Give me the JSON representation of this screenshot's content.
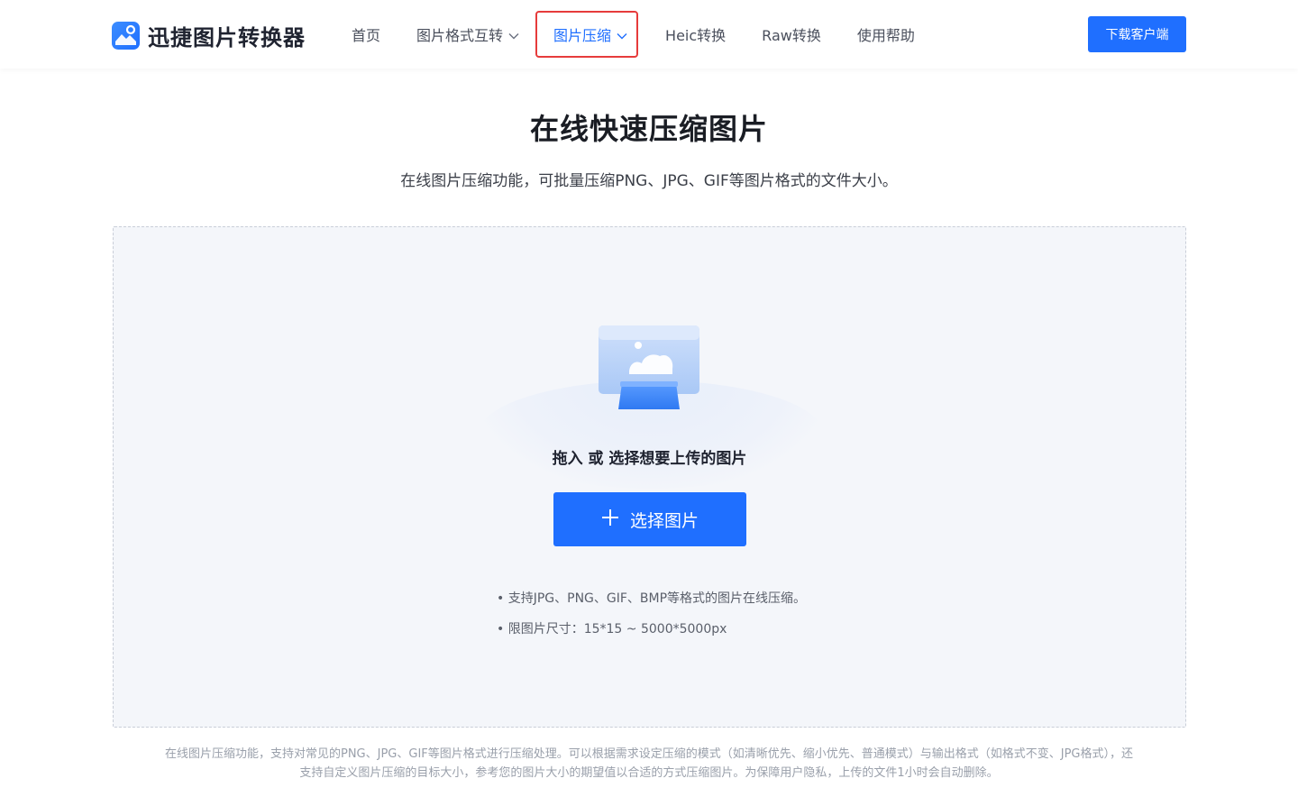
{
  "header": {
    "logo_text": "迅捷图片转换器",
    "nav": [
      {
        "label": "首页"
      },
      {
        "label": "图片格式互转"
      },
      {
        "label": "图片压缩"
      },
      {
        "label": "Heic转换"
      },
      {
        "label": "Raw转换"
      },
      {
        "label": "使用帮助"
      }
    ],
    "download_label": "下载客户端"
  },
  "hero": {
    "title": "在线快速压缩图片",
    "subtitle": "在线图片压缩功能，可批量压缩PNG、JPG、GIF等图片格式的文件大小。"
  },
  "upload": {
    "drop_text": "拖入 或 选择想要上传的图片",
    "select_label": "选择图片",
    "tips": [
      "• 支持JPG、PNG、GIF、BMP等格式的图片在线压缩。",
      "• 限图片尺寸：15*15 ~ 5000*5000px"
    ]
  },
  "footer_note": "在线图片压缩功能，支持对常见的PNG、JPG、GIF等图片格式进行压缩处理。可以根据需求设定压缩的模式（如清晰优先、缩小优先、普通模式）与输出格式（如格式不变、JPG格式），还支持自定义图片压缩的目标大小，参考您的图片大小的期望值以合适的方式压缩图片。为保障用户隐私，上传的文件1小时会自动删除。",
  "colors": {
    "accent": "#1f6fff",
    "active_outline": "#e63b3b",
    "upload_bg": "#f4f6fa"
  },
  "icons": [
    "logo-icon",
    "chevron-down-icon",
    "image-upload-illustration",
    "plus-icon"
  ]
}
